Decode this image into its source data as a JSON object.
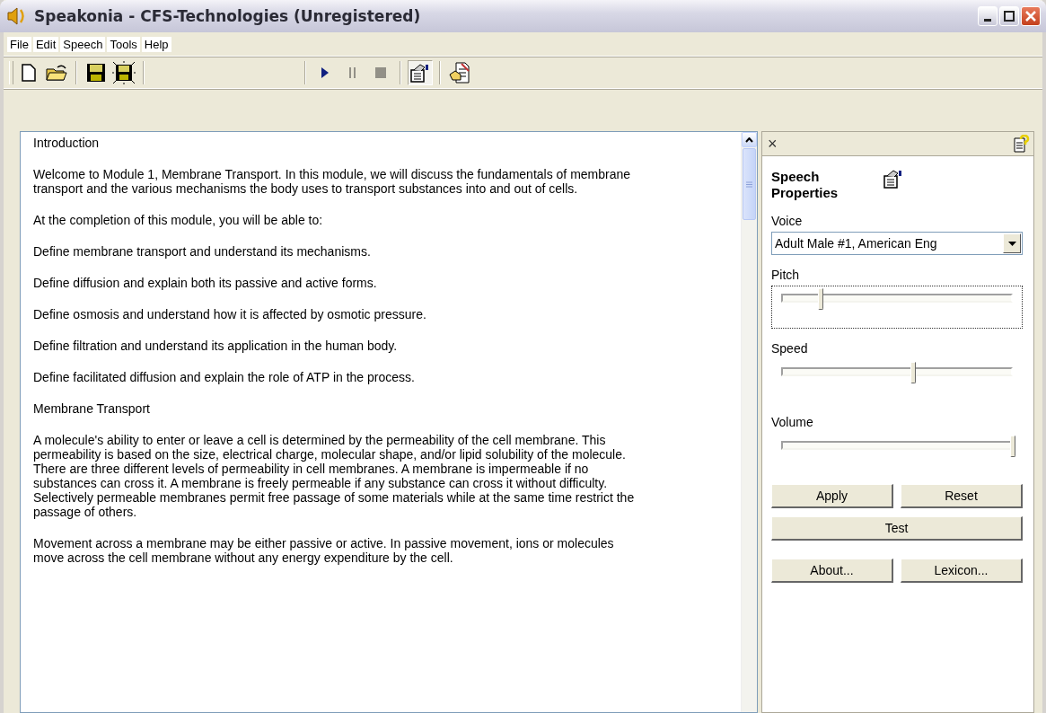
{
  "window": {
    "title": "Speakonia - CFS-Technologies (Unregistered)"
  },
  "menu": [
    "File",
    "Edit",
    "Speech",
    "Tools",
    "Help"
  ],
  "toolbar": [
    {
      "kind": "new",
      "disabled": false,
      "pressed": false
    },
    {
      "kind": "open",
      "disabled": false,
      "pressed": false
    },
    {
      "kind": "sep"
    },
    {
      "kind": "save",
      "disabled": false,
      "pressed": false
    },
    {
      "kind": "export",
      "disabled": false,
      "pressed": false
    },
    {
      "kind": "sep"
    },
    {
      "kind": "gap"
    },
    {
      "kind": "sep"
    },
    {
      "kind": "play",
      "disabled": false,
      "pressed": false
    },
    {
      "kind": "pause",
      "disabled": true,
      "pressed": false
    },
    {
      "kind": "stop",
      "disabled": true,
      "pressed": false
    },
    {
      "kind": "sep"
    },
    {
      "kind": "properties",
      "disabled": false,
      "pressed": true
    },
    {
      "kind": "sep"
    },
    {
      "kind": "lexicon",
      "disabled": false,
      "pressed": false
    }
  ],
  "document": {
    "paragraphs": [
      "Introduction",
      "Welcome to Module 1, Membrane Transport. In this module, we will discuss the fundamentals of membrane transport and the various mechanisms the body uses to transport substances into and out of cells.",
      "At the completion of this module, you will be able to:",
      "Define membrane transport and understand its mechanisms.",
      "Define diffusion and explain both its passive and active forms.",
      "Define osmosis and understand how it is affected by osmotic pressure.",
      "Define filtration and understand its application in the human body.",
      "Define facilitated diffusion and explain the role of ATP in the process.",
      "Membrane Transport",
      "A molecule's ability to enter or leave a cell is determined by the permeability of the cell membrane. This permeability is based on the size, electrical charge, molecular shape, and/or lipid solubility of the molecule. There are three different levels of permeability in cell membranes. A membrane is impermeable if no substances can cross it. A membrane is freely permeable if any substance can cross it without difficulty. Selectively permeable membranes permit free passage of some materials while at the same time restrict the passage of others.",
      "Movement across a membrane may be either passive or active. In passive movement, ions or molecules move across the cell membrane without any energy expenditure by the cell."
    ]
  },
  "panel": {
    "close": "×",
    "title": "Speech Properties",
    "voice_label": "Voice",
    "voice": "Adult Male #1, American Eng",
    "sliders": [
      {
        "label": "Pitch",
        "level": 0.17,
        "focused": true
      },
      {
        "label": "Speed",
        "level": 0.57,
        "focused": false
      },
      {
        "label": "Volume",
        "level": 1.0,
        "focused": false
      }
    ],
    "button_rows": [
      [
        "Apply",
        "Reset"
      ],
      [
        "Test"
      ],
      [
        "About...",
        "Lexicon..."
      ]
    ]
  }
}
